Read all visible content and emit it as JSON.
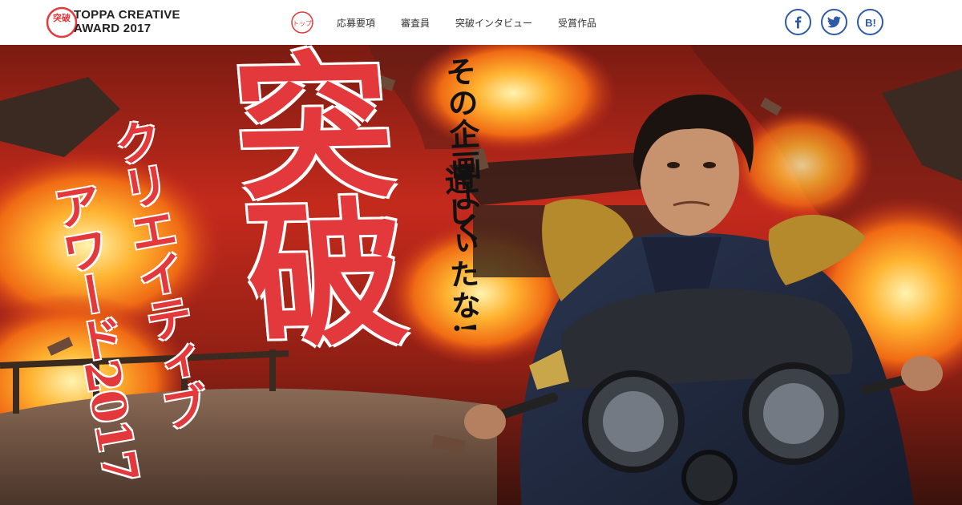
{
  "header": {
    "brand_line1": "TOPPA CREATIVE",
    "brand_line2": "AWARD 2017",
    "logo_text": "突破",
    "home_icon_text": "トップ",
    "nav": [
      {
        "label": "応募要項"
      },
      {
        "label": "審査員"
      },
      {
        "label": "突破インタビュー"
      },
      {
        "label": "受賞作品"
      }
    ],
    "social": [
      {
        "icon": "facebook-icon",
        "glyph": "f"
      },
      {
        "icon": "twitter-icon",
        "glyph": "t"
      },
      {
        "icon": "hatena-bookmark-icon",
        "glyph": "B!"
      }
    ]
  },
  "hero": {
    "catch_line1": "その企画よく",
    "catch_line2": "通しぃたな!",
    "title_main": "突破",
    "title_sub1": "クリエイティブ",
    "title_sub2": "アワード2017"
  },
  "colors": {
    "accent_red": "#e4393c",
    "social_blue": "#2f5aa6",
    "sky_red": "#c42a1c",
    "nav_text": "#333333"
  }
}
